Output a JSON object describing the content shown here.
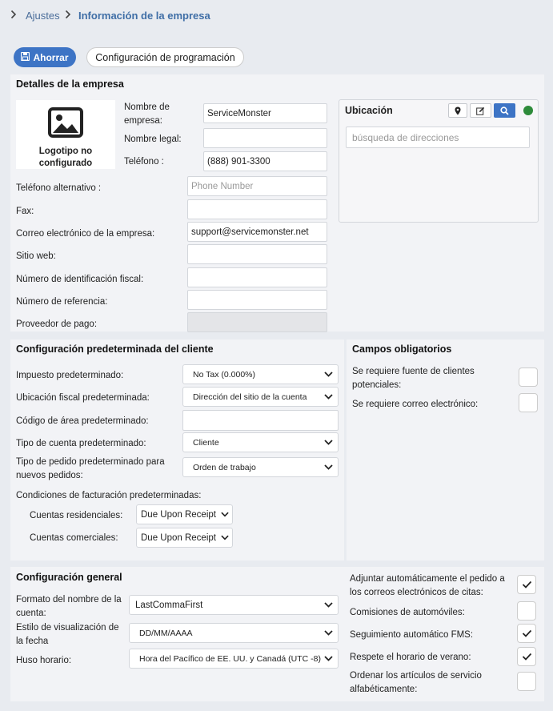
{
  "breadcrumb": {
    "parent": "Ajustes",
    "current": "Información de la empresa"
  },
  "toolbar": {
    "save_label": "Ahorrar",
    "schedule_label": "Configuración de programación"
  },
  "company": {
    "title": "Detalles de la empresa",
    "logo_text": "Logotipo no configurado",
    "name_label": "Nombre de empresa:",
    "name_value": "ServiceMonster",
    "legal_label": "Nombre legal:",
    "legal_value": "",
    "phone_label": "Teléfono :",
    "phone_value": "(888) 901-3300",
    "alt_phone_label": "Teléfono alternativo :",
    "alt_phone_placeholder": "Phone Number",
    "fax_label": "Fax:",
    "email_label": "Correo electrónico de la empresa:",
    "email_value": "support@servicemonster.net",
    "website_label": "Sitio web:",
    "taxid_label": "Número de identificación fiscal:",
    "ref_label": "Número de referencia:",
    "payment_label": "Proveedor de pago:"
  },
  "location": {
    "title": "Ubicación",
    "search_placeholder": "búsqueda de direcciones",
    "status_color": "#2e8b3a"
  },
  "customer_defaults": {
    "title": "Configuración predeterminada del cliente",
    "tax_label": "Impuesto predeterminado:",
    "tax_value": "No Tax (0.000%)",
    "taxloc_label": "Ubicación fiscal predeterminada:",
    "taxloc_value": "Dirección del sitio de la cuenta",
    "area_label": "Código de área predeterminado:",
    "area_value": "",
    "acct_type_label": "Tipo de cuenta predeterminado:",
    "acct_type_value": "Cliente",
    "order_type_label": "Tipo de pedido predeterminado para nuevos pedidos:",
    "order_type_value": "Orden de trabajo",
    "billing_label": "Condiciones de facturación predeterminadas:",
    "residential_label": "Cuentas residenciales:",
    "residential_value": "Due Upon Receipt",
    "commercial_label": "Cuentas comerciales:",
    "commercial_value": "Due Upon Receipt"
  },
  "required_fields": {
    "title": "Campos obligatorios",
    "lead_source_label": "Se requiere fuente de clientes potenciales:",
    "lead_source_checked": false,
    "email_label": "Se requiere correo electrónico:",
    "email_checked": false
  },
  "general": {
    "title": "Configuración general",
    "name_format_label": "Formato del nombre de la cuenta:",
    "name_format_value": "LastCommaFirst",
    "date_format_label": "Estilo de visualización de la fecha",
    "date_format_value": "DD/MM/AAAA",
    "timezone_label": "Huso horario:",
    "timezone_value": "Hora del Pacífico de EE. UU. y Canadá (UTC -8)",
    "attach_label": "Adjuntar automáticamente el pedido a los correos electrónicos de citas:",
    "attach_checked": true,
    "auto_comm_label": "Comisiones de automóviles:",
    "auto_comm_checked": false,
    "fms_label": "Seguimiento automático FMS:",
    "fms_checked": true,
    "dst_label": "Respete el horario de verano:",
    "dst_checked": true,
    "sort_label": "Ordenar los artículos de servicio alfabéticamente:",
    "sort_checked": false
  }
}
